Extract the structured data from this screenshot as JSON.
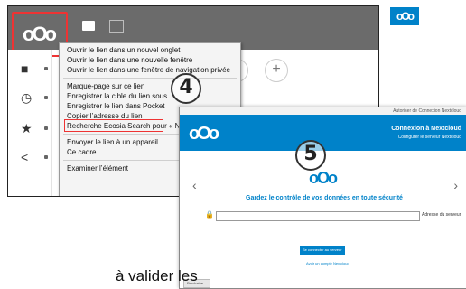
{
  "context_menu": {
    "items": [
      "Ouvrir le lien dans un nouvel onglet",
      "Ouvrir le lien dans une nouvelle fenêtre",
      "Ouvrir le lien dans une fenêtre de navigation privée",
      "Marque-page sur ce lien",
      "Enregistrer la cible du lien sous…",
      "Enregistrer le lien dans Pocket",
      "Copier l’adresse du lien",
      "Recherche Ecosia Search pour « Ne",
      "Envoyer le lien à un appareil",
      "Ce cadre",
      "Examiner l’élément"
    ]
  },
  "steps": {
    "four": "4",
    "five": "5"
  },
  "login": {
    "window_title": "Autoriser de Connexion Nextcloud",
    "banner_title": "Connexion à Nextcloud",
    "banner_sub": "Configurer le serveur Nextcloud",
    "heading": "Gardez le contrôle de vos données en toute sécurité",
    "field_label": "Adresse du serveur",
    "button": "Se connecter au serveur",
    "link": "Avoir un compte Nextcloud",
    "corner_button": "Prochaine"
  },
  "bottom_text": "à valider les",
  "colors": {
    "nextcloud_blue": "#0082c9",
    "highlight_red": "#e33333"
  }
}
